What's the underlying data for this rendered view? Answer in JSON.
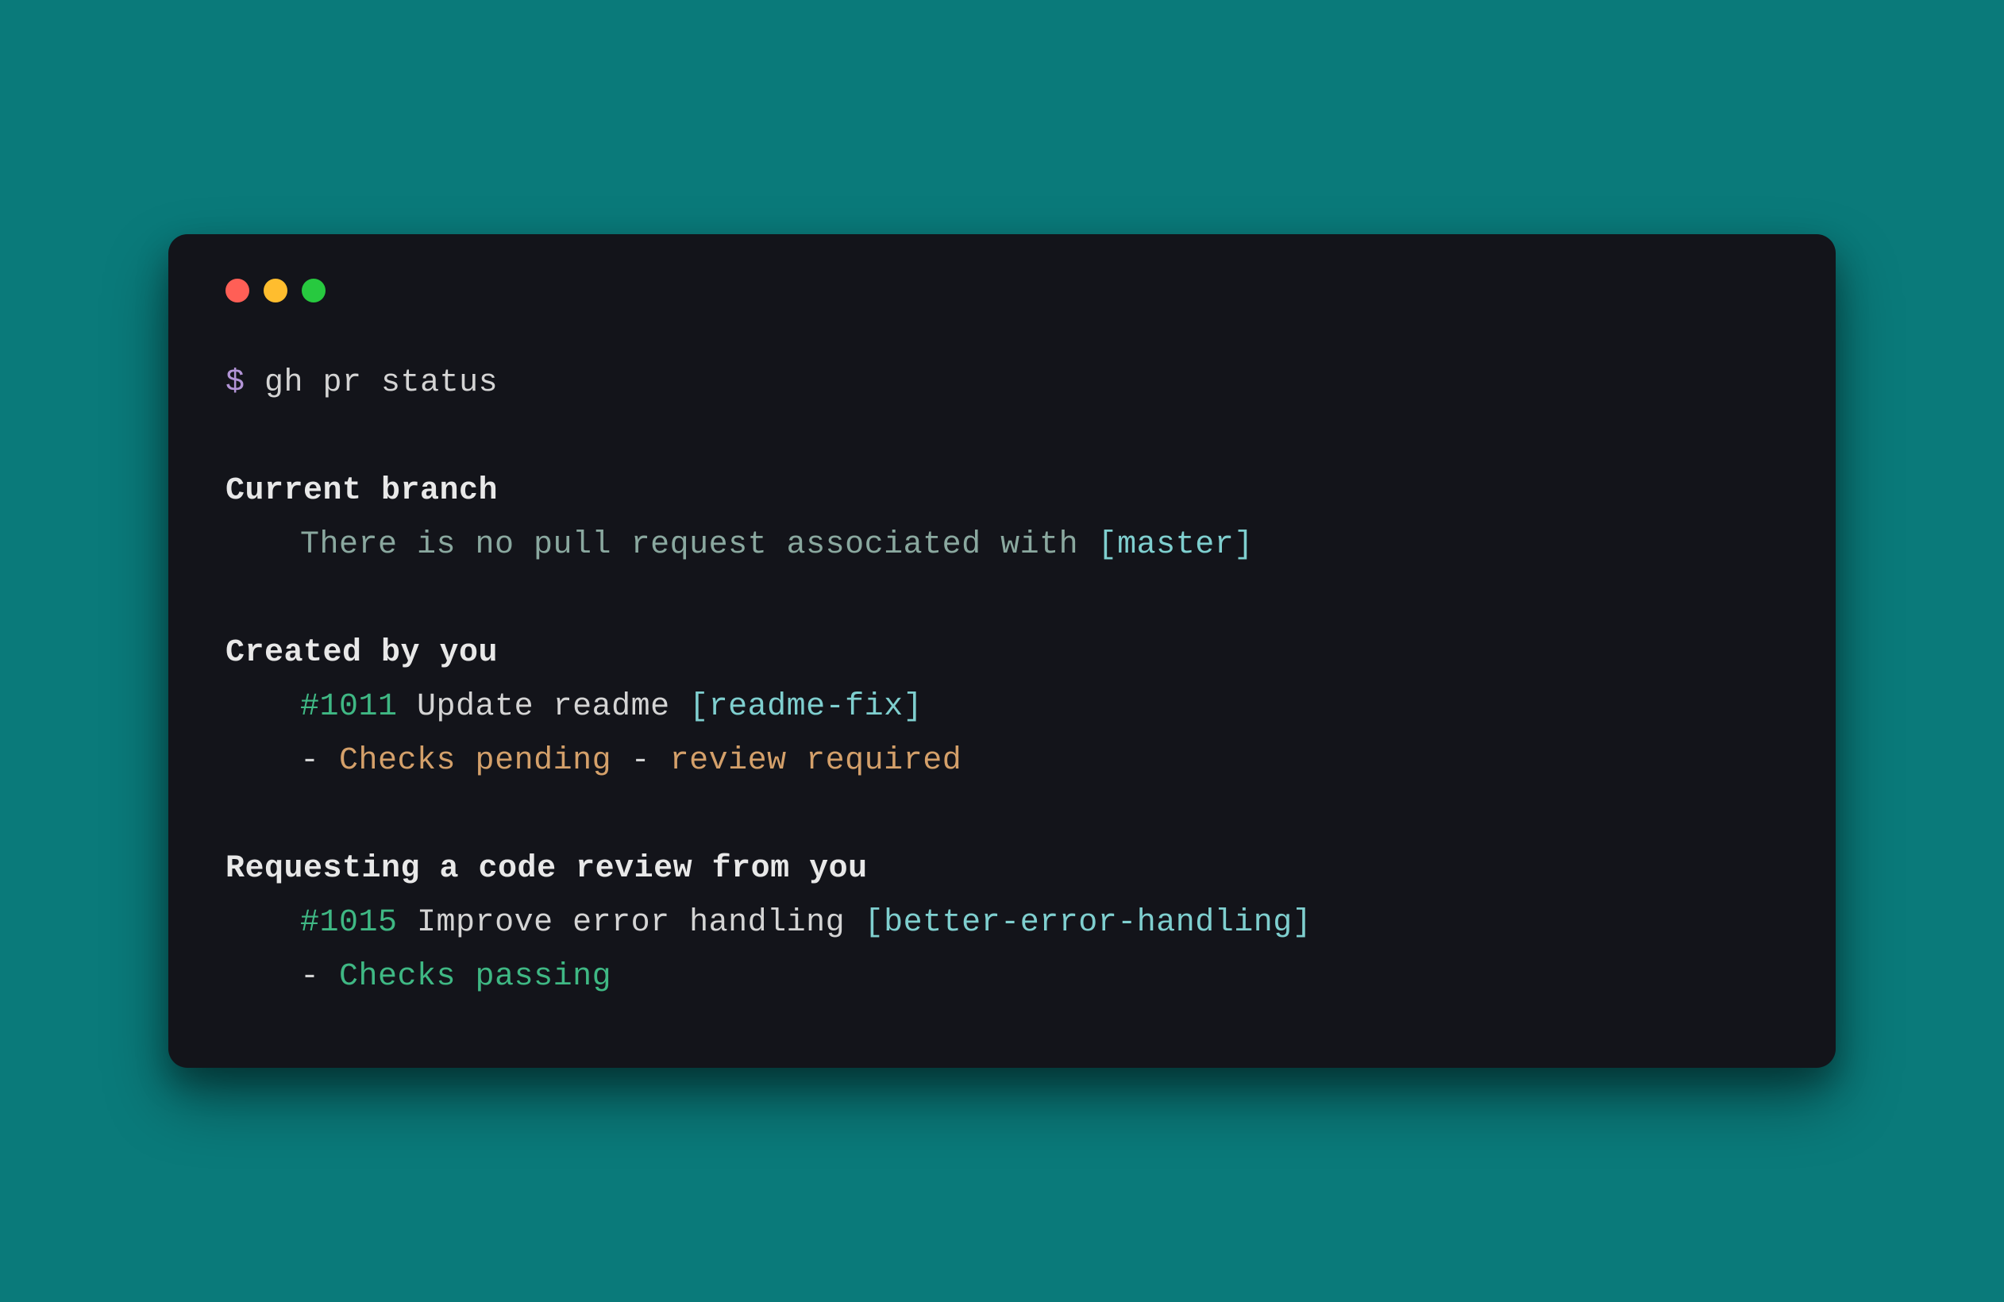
{
  "prompt": {
    "symbol": "$",
    "command": "gh pr status"
  },
  "sections": {
    "current_branch": {
      "header": "Current branch",
      "message": "There is no pull request associated with ",
      "branch": "[master]"
    },
    "created_by_you": {
      "header": "Created by you",
      "pr_number": "#1011",
      "pr_title": "Update readme",
      "branch": "[readme-fix]",
      "status_dash1": "-",
      "status_checks": "Checks pending",
      "status_dash2": "-",
      "status_review": "review required"
    },
    "requesting_review": {
      "header": "Requesting a code review from you",
      "pr_number": "#1015",
      "pr_title": "Improve error handling",
      "branch": "[better-error-handling]",
      "status_dash": "-",
      "status_checks": "Checks passing"
    }
  }
}
